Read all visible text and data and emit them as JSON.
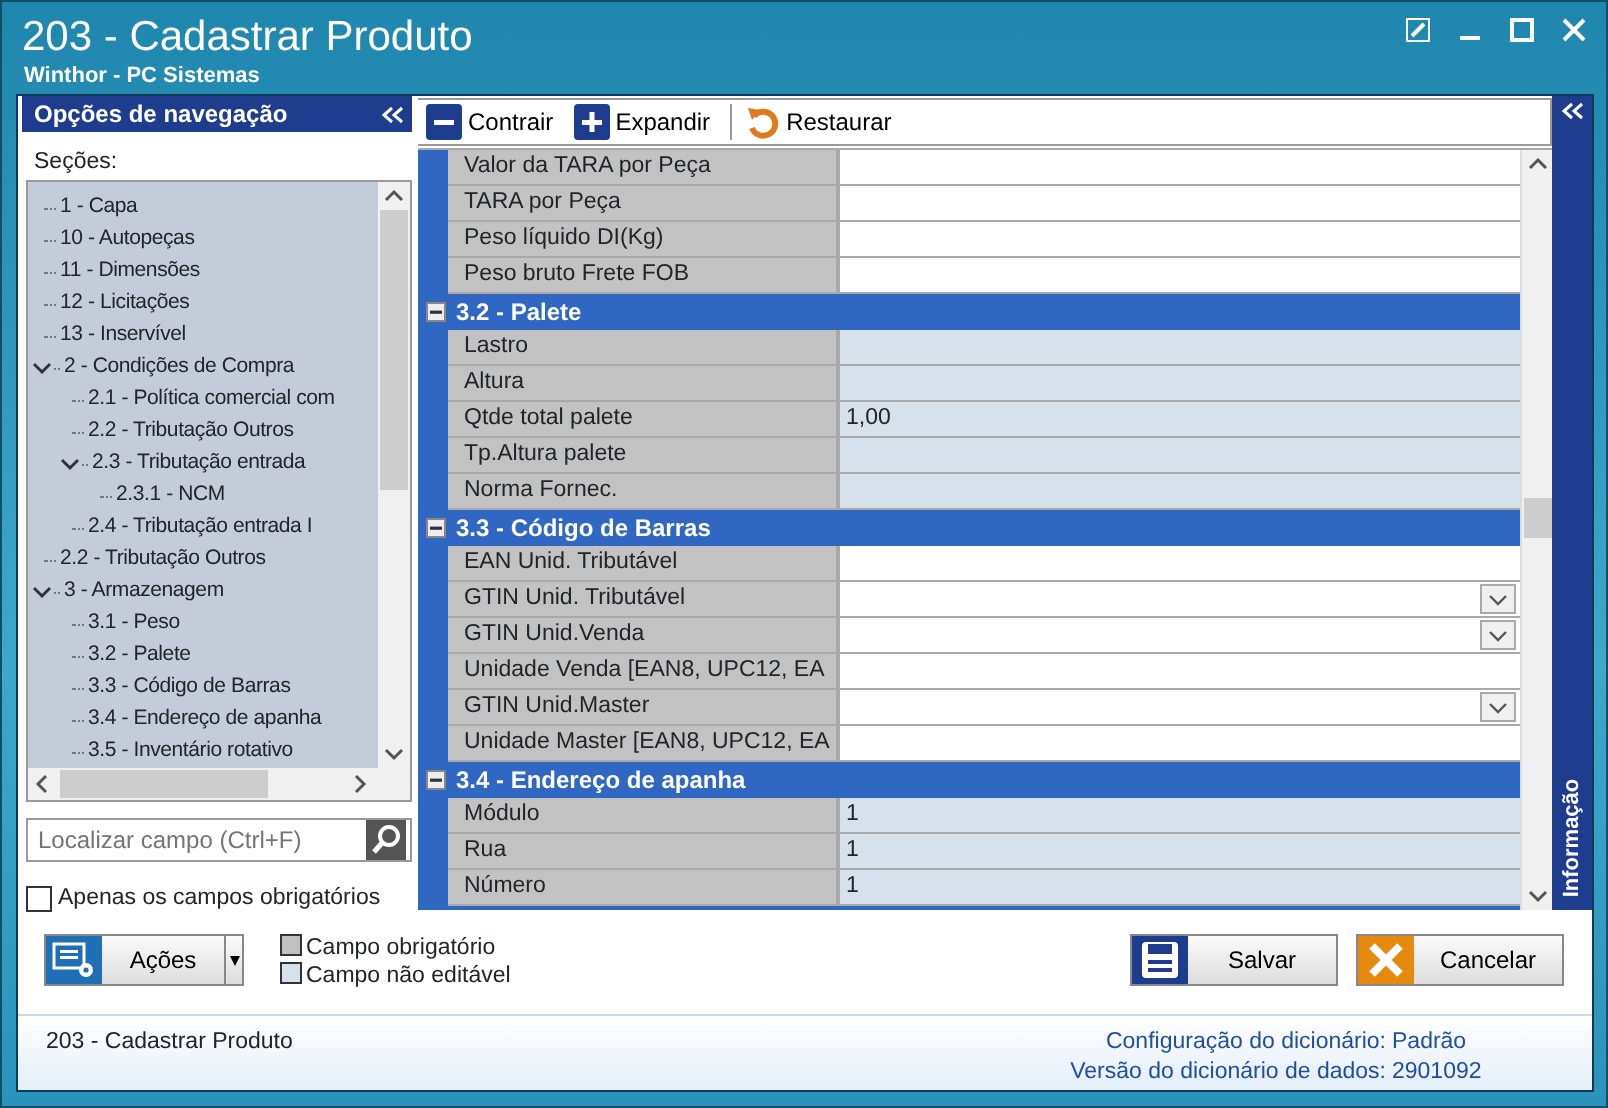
{
  "window": {
    "title": "203 - Cadastrar  Produto",
    "subtitle": "Winthor - PC Sistemas"
  },
  "nav": {
    "title": "Opções de navegação",
    "sections_label": "Seções:",
    "tree": [
      {
        "label": "1 - Capa"
      },
      {
        "label": "10 - Autopeças"
      },
      {
        "label": "11 - Dimensões"
      },
      {
        "label": "12 - Licitações"
      },
      {
        "label": "13 - Inservível"
      },
      {
        "label": "2 - Condições de Compra",
        "expanded": true,
        "children": [
          {
            "label": "2.1 - Política comercial com"
          },
          {
            "label": "2.2 - Tributação Outros"
          },
          {
            "label": "2.3 - Tributação entrada",
            "expanded": true,
            "children": [
              {
                "label": "2.3.1 - NCM"
              }
            ]
          },
          {
            "label": "2.4 - Tributação entrada I"
          }
        ]
      },
      {
        "label": "2.2 - Tributação Outros"
      },
      {
        "label": "3 - Armazenagem",
        "expanded": true,
        "children": [
          {
            "label": "3.1 - Peso"
          },
          {
            "label": "3.2 - Palete"
          },
          {
            "label": "3.3 - Código de Barras"
          },
          {
            "label": "3.4 - Endereço de apanha"
          },
          {
            "label": "3.5 - Inventário rotativo"
          }
        ]
      }
    ],
    "search": {
      "placeholder": "Localizar campo (Ctrl+F)"
    },
    "required_only": {
      "label": "Apenas os campos obrigatórios",
      "checked": false
    }
  },
  "toolbar": [
    {
      "label": "Contrair",
      "kind": "collapse"
    },
    {
      "label": "Expandir",
      "kind": "expand"
    },
    {
      "label": "Restaurar",
      "kind": "restore"
    }
  ],
  "grid": {
    "rows": [
      {
        "kind": "field",
        "label": "Valor da TARA por Peça",
        "value": "",
        "editable": true
      },
      {
        "kind": "field",
        "label": "TARA por Peça",
        "value": "",
        "editable": true
      },
      {
        "kind": "field",
        "label": "Peso líquido DI(Kg)",
        "value": "",
        "editable": true
      },
      {
        "kind": "field",
        "label": "Peso bruto Frete FOB",
        "value": "",
        "editable": true
      },
      {
        "kind": "header",
        "label": "3.2 - Palete",
        "expanded": true
      },
      {
        "kind": "field",
        "label": "Lastro",
        "value": "",
        "editable": false
      },
      {
        "kind": "field",
        "label": "Altura",
        "value": "",
        "editable": false
      },
      {
        "kind": "field",
        "label": "Qtde total palete",
        "value": "1,00",
        "editable": false
      },
      {
        "kind": "field",
        "label": "Tp.Altura palete",
        "value": "",
        "editable": false
      },
      {
        "kind": "field",
        "label": "Norma Fornec.",
        "value": "",
        "editable": false
      },
      {
        "kind": "header",
        "label": "3.3 - Código de Barras",
        "expanded": true
      },
      {
        "kind": "field",
        "label": "EAN Unid. Tributável",
        "value": "",
        "editable": true
      },
      {
        "kind": "dropdown",
        "label": "GTIN Unid. Tributável",
        "value": "",
        "editable": true
      },
      {
        "kind": "dropdown",
        "label": "GTIN Unid.Venda",
        "value": "",
        "editable": true
      },
      {
        "kind": "field",
        "label": "Unidade Venda [EAN8, UPC12, EA",
        "value": "",
        "editable": true
      },
      {
        "kind": "dropdown",
        "label": "GTIN Unid.Master",
        "value": "",
        "editable": true
      },
      {
        "kind": "field",
        "label": "Unidade Master [EAN8, UPC12, EA",
        "value": "",
        "editable": true
      },
      {
        "kind": "header",
        "label": "3.4 - Endereço de apanha",
        "expanded": true
      },
      {
        "kind": "field",
        "label": "Módulo",
        "value": "1",
        "editable": false
      },
      {
        "kind": "field",
        "label": "Rua",
        "value": "1",
        "editable": false
      },
      {
        "kind": "field",
        "label": "Número",
        "value": "1",
        "editable": false
      }
    ]
  },
  "info_panel": {
    "title": "Informação"
  },
  "actions_button": {
    "label": "Ações"
  },
  "legend": [
    {
      "label": "Campo obrigatório",
      "color": "#c0c0c0"
    },
    {
      "label": "Campo não editável",
      "color": "#d6e1ec"
    }
  ],
  "buttons": [
    {
      "label": "Salvar",
      "kind": "save"
    },
    {
      "label": "Cancelar",
      "kind": "cancel"
    }
  ],
  "status_bar": {
    "left": "203 - Cadastrar  Produto",
    "items": [
      {
        "label": "Configuração do dicionário:",
        "value": "Padrão"
      },
      {
        "label": "Versão do dicionário de dados:",
        "value": "2901092"
      }
    ]
  }
}
